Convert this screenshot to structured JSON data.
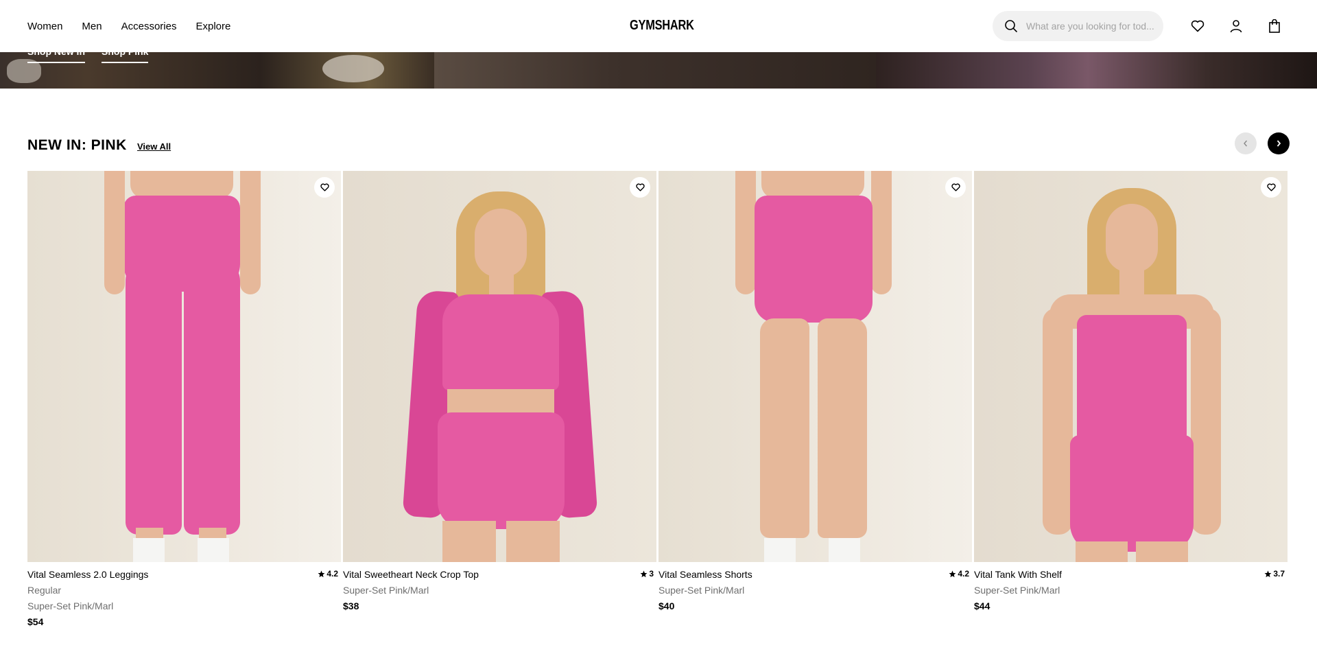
{
  "header": {
    "nav": [
      "Women",
      "Men",
      "Accessories",
      "Explore"
    ],
    "logo": "GYMSHARK",
    "search_placeholder": "What are you looking for tod..."
  },
  "hero": {
    "links": [
      "Shop New In",
      "Shop Pink"
    ]
  },
  "section": {
    "title": "NEW IN: PINK",
    "view_all": "View All"
  },
  "products": [
    {
      "name": "Vital Seamless 2.0 Leggings",
      "rating": "4.2",
      "fit": "Regular",
      "color": "Super-Set Pink/Marl",
      "price": "$54"
    },
    {
      "name": "Vital Sweetheart Neck Crop Top",
      "rating": "3",
      "color": "Super-Set Pink/Marl",
      "price": "$38"
    },
    {
      "name": "Vital Seamless Shorts",
      "rating": "4.2",
      "color": "Super-Set Pink/Marl",
      "price": "$40"
    },
    {
      "name": "Vital Tank With Shelf",
      "rating": "3.7",
      "color": "Super-Set Pink/Marl",
      "price": "$44"
    }
  ],
  "colors": {
    "product_pink": "#e55aa2",
    "text_muted": "#6e6e6e",
    "search_bg": "#f1f1f1"
  }
}
